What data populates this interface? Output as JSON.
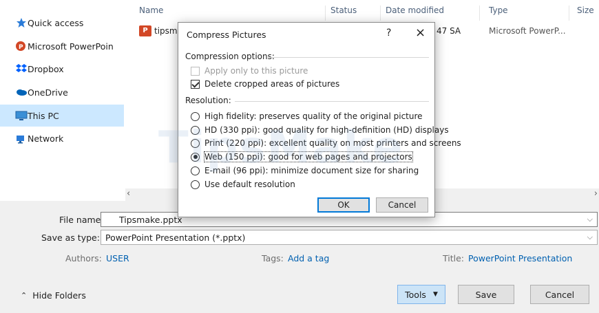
{
  "nav": {
    "items": [
      {
        "label": "Quick access",
        "icon": "star-icon",
        "color": "#2a7bd8"
      },
      {
        "label": "Microsoft PowerPoin",
        "icon": "powerpoint-icon",
        "color": "#d24726"
      },
      {
        "label": "Dropbox",
        "icon": "dropbox-icon",
        "color": "#0061fe"
      },
      {
        "label": "OneDrive",
        "icon": "onedrive-icon",
        "color": "#0364b8"
      },
      {
        "label": "This PC",
        "icon": "pc-icon",
        "color": "#3a8fd6"
      },
      {
        "label": "Network",
        "icon": "network-icon",
        "color": "#2a7bd8"
      }
    ],
    "selected": "This PC"
  },
  "list": {
    "columns": [
      "Name",
      "Status",
      "Date modified",
      "Type",
      "Size"
    ],
    "rows": [
      {
        "name": "tipsma",
        "date": "47 SA",
        "type": "Microsoft PowerP..."
      }
    ]
  },
  "save": {
    "file_name_label": "File name:",
    "file_name_value": "Tipsmake.pptx",
    "save_type_label": "Save as type:",
    "save_type_value": "PowerPoint Presentation (*.pptx)",
    "authors_label": "Authors:",
    "authors_value": "USER",
    "tags_label": "Tags:",
    "tags_value": "Add a tag",
    "title_label": "Title:",
    "title_value": "PowerPoint Presentation",
    "hide_folders": "Hide Folders",
    "tools": "Tools",
    "save_btn": "Save",
    "cancel_btn": "Cancel"
  },
  "dialog": {
    "title": "Compress Pictures",
    "help": "?",
    "close": "×",
    "compression_label": "Compression options:",
    "apply_only": "Apply only to this picture",
    "delete_cropped": "Delete cropped areas of pictures",
    "resolution_label": "Resolution:",
    "resolutions": [
      "High fidelity: preserves quality of the original picture",
      "HD (330 ppi): good quality for high-definition (HD) displays",
      "Print (220 ppi): excellent quality on most printers and screens",
      "Web (150 ppi): good for web pages and projectors",
      "E-mail (96 ppi): minimize document size for sharing",
      "Use default resolution"
    ],
    "selected_resolution": "Web (150 ppi): good for web pages and projectors",
    "ok": "OK",
    "cancel": "Cancel"
  },
  "watermark": "TipsMake"
}
